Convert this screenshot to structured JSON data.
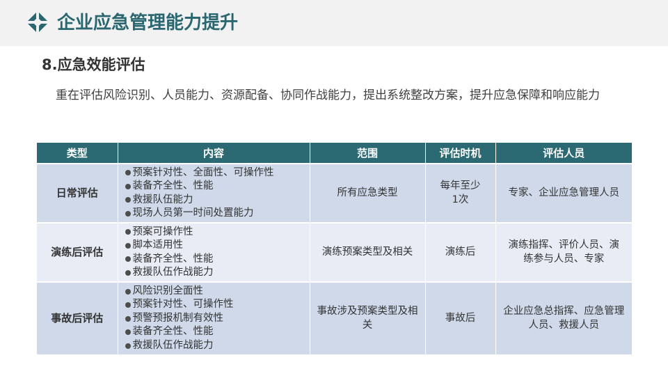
{
  "header": {
    "title": "企业应急管理能力提升",
    "logo_icon": "diamond-logo-icon"
  },
  "section": {
    "title": "8.应急效能评估",
    "intro": "重在评估风险识别、人员能力、资源配备、协同作战能力，提出系统整改方案，提升应急保障和响应能力"
  },
  "colors": {
    "accent": "#2b6770",
    "header_row": "#2b6a72",
    "row_dark": "#cfd9e9",
    "row_light": "#e7ecf5"
  },
  "table": {
    "headers": [
      "类型",
      "内容",
      "范围",
      "评估时机",
      "评估人员"
    ],
    "rows": [
      {
        "type": "日常评估",
        "content": [
          "预案针对性、全面性、可操作性",
          "装备齐全性、性能",
          "救援队伍能力",
          "现场人员第一时间处置能力"
        ],
        "scope": "所有应急类型",
        "timing": "每年至少1次",
        "personnel": "专家、企业应急管理人员"
      },
      {
        "type": "演练后评估",
        "content": [
          "预案可操作性",
          "脚本适用性",
          "装备齐全性、性能",
          "救援队伍作战能力"
        ],
        "scope": "演练预案类型及相关",
        "timing": "演练后",
        "personnel": "演练指挥、评价人员、演练参与人员、专家"
      },
      {
        "type": "事故后评估",
        "content": [
          "风险识别全面性",
          "预案针对性、可操作性",
          "预警预报机制有效性",
          "装备齐全性、性能",
          "救援队伍作战能力"
        ],
        "scope": "事故涉及预案类型及相关",
        "timing": "事故后",
        "personnel": "企业应急总指挥、应急管理人员、救援人员"
      }
    ]
  }
}
